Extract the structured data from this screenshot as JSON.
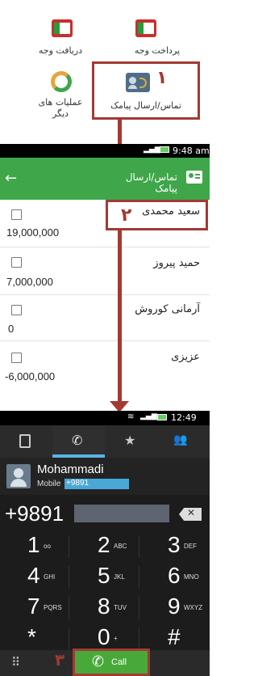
{
  "menu": {
    "tiles": [
      {
        "label": "پرداخت وجه",
        "icon": "card-red-icon"
      },
      {
        "label": "دریافت وجه",
        "icon": "card-red-icon"
      },
      {
        "label": "تماس/ارسال پیامک",
        "icon": "contact-card-icon"
      },
      {
        "label": "عملیات های دیگر",
        "icon": "ring-icon"
      }
    ],
    "step_labels": [
      "١",
      "٢",
      "٣"
    ]
  },
  "contacts_screen": {
    "status_time": "9:48 am",
    "title": "تماس/ارسال پیامک",
    "rows": [
      {
        "name": "سعید محمدی",
        "amount": "19,000,000"
      },
      {
        "name": "حمید پیروز",
        "amount": "7,000,000"
      },
      {
        "name": "آرمانی کوروش",
        "amount": "0"
      },
      {
        "name": "عزیزی",
        "amount": "-6,000,000"
      }
    ]
  },
  "dialer": {
    "status_time": "12:49 pm",
    "contact_name": "Mohammadi",
    "contact_type": "Mobile",
    "contact_number": "+9891",
    "typed_number": "+9891",
    "keys": [
      {
        "digit": "1",
        "letters": "ᴏᴏ"
      },
      {
        "digit": "2",
        "letters": "ABC"
      },
      {
        "digit": "3",
        "letters": "DEF"
      },
      {
        "digit": "4",
        "letters": "GHI"
      },
      {
        "digit": "5",
        "letters": "JKL"
      },
      {
        "digit": "6",
        "letters": "MNO"
      },
      {
        "digit": "7",
        "letters": "PQRS"
      },
      {
        "digit": "8",
        "letters": "TUV"
      },
      {
        "digit": "9",
        "letters": "WXYZ"
      },
      {
        "digit": "*",
        "letters": ""
      },
      {
        "digit": "0",
        "letters": "+"
      },
      {
        "digit": "#",
        "letters": ""
      }
    ],
    "call_label": "Call"
  },
  "colors": {
    "accent_red": "#a23a33",
    "app_green": "#3fa64a",
    "call_green": "#48a93a"
  }
}
